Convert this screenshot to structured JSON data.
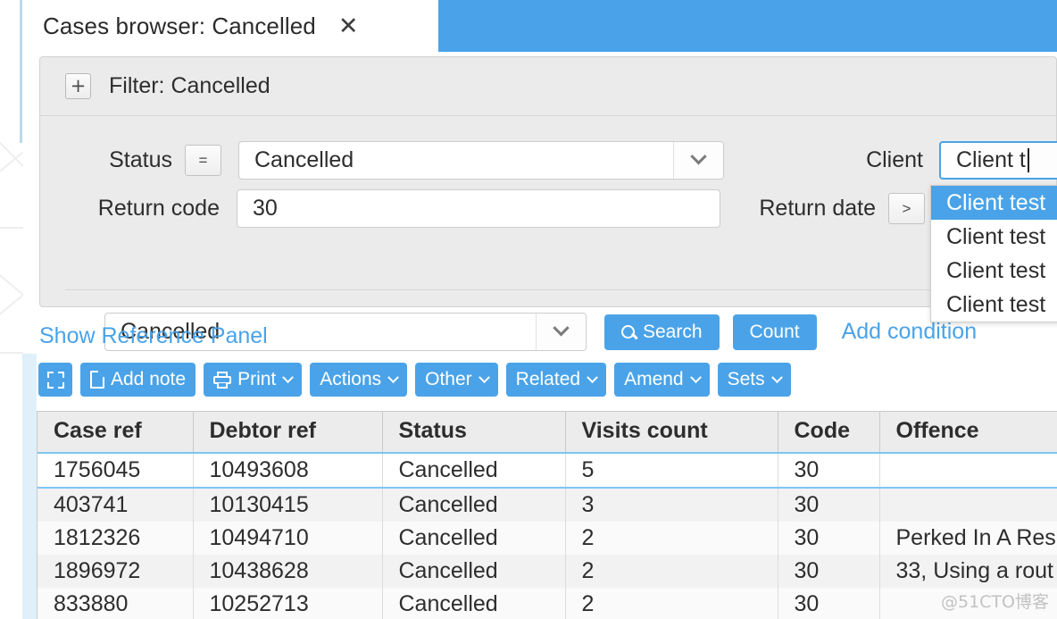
{
  "tab": {
    "title": "Cases browser: Cancelled",
    "close_icon": "close-icon"
  },
  "filter": {
    "expand_icon": "plus-icon",
    "header_label": "Filter: Cancelled",
    "conditions": [
      {
        "label": "Status",
        "operator": "=",
        "value": "Cancelled",
        "control": "select"
      },
      {
        "label": "Return code",
        "operator": "",
        "value": "30",
        "control": "text"
      },
      {
        "label": "Client",
        "operator": "",
        "value": "Client t",
        "control": "autocomplete"
      },
      {
        "label": "Return date",
        "operator": ">",
        "value": "",
        "control": "text"
      }
    ],
    "saved_filter": "Cancelled",
    "search_label": "Search",
    "count_label": "Count",
    "add_condition_label": "Add condition",
    "search_icon": "search-icon",
    "dropdown_icon": "chevron-down-icon"
  },
  "autocomplete": {
    "items": [
      {
        "label": "Client test",
        "selected": true
      },
      {
        "label": "Client test",
        "selected": false
      },
      {
        "label": "Client test",
        "selected": false
      },
      {
        "label": "Client test",
        "selected": false
      }
    ]
  },
  "reference_panel_link": "Show Reference Panel",
  "toolbar": {
    "buttons": [
      {
        "label": "",
        "icon": "expand-icon",
        "caret": false
      },
      {
        "label": "Add note",
        "icon": "document-icon",
        "caret": false
      },
      {
        "label": "Print",
        "icon": "printer-icon",
        "caret": true
      },
      {
        "label": "Actions",
        "icon": "",
        "caret": true
      },
      {
        "label": "Other",
        "icon": "",
        "caret": true
      },
      {
        "label": "Related",
        "icon": "",
        "caret": true
      },
      {
        "label": "Amend",
        "icon": "",
        "caret": true
      },
      {
        "label": "Sets",
        "icon": "",
        "caret": true
      }
    ]
  },
  "results": {
    "columns": [
      "Case ref",
      "Debtor ref",
      "Status",
      "Visits count",
      "Code",
      "Offence"
    ],
    "rows": [
      {
        "case_ref": "1756045",
        "debtor_ref": "10493608",
        "status": "Cancelled",
        "visits_count": "5",
        "code": "30",
        "offence": "",
        "selected": true
      },
      {
        "case_ref": "403741",
        "debtor_ref": "10130415",
        "status": "Cancelled",
        "visits_count": "3",
        "code": "30",
        "offence": "",
        "selected": false
      },
      {
        "case_ref": "1812326",
        "debtor_ref": "10494710",
        "status": "Cancelled",
        "visits_count": "2",
        "code": "30",
        "offence": "Perked In A Res",
        "selected": false
      },
      {
        "case_ref": "1896972",
        "debtor_ref": "10438628",
        "status": "Cancelled",
        "visits_count": "2",
        "code": "30",
        "offence": "33, Using a rout",
        "selected": false
      },
      {
        "case_ref": "833880",
        "debtor_ref": "10252713",
        "status": "Cancelled",
        "visits_count": "2",
        "code": "30",
        "offence": "",
        "selected": false
      }
    ]
  },
  "watermark": "@51CTO博客",
  "colors": {
    "accent": "#4aa3e8",
    "panel_bg": "#ebebeb",
    "selected_row_border": "#7cc6f2"
  }
}
